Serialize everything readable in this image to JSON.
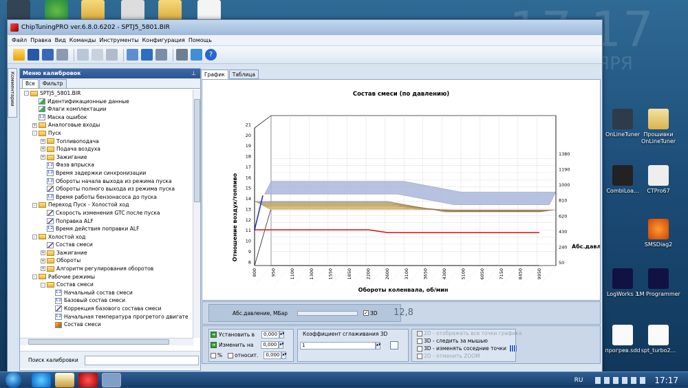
{
  "window": {
    "title": "ChipTuningPRO ver.6.8.0.6202 - SPTJ5_5801.BIR"
  },
  "menu": [
    "Файл",
    "Правка",
    "Вид",
    "Команды",
    "Инструменты",
    "Конфигурация",
    "Помощь"
  ],
  "sidetab_label": "Комментарии",
  "left_panel": {
    "title": "Меню калибровок",
    "pin": "⊥",
    "tabs": [
      "Все",
      "Фильтр"
    ],
    "search_label": "Поиск калибровки",
    "tree": [
      {
        "level": 0,
        "exp": "-",
        "icon": "folder",
        "label": "SPTJ5_5801.BIR"
      },
      {
        "level": 1,
        "exp": "",
        "icon": "leaf-g",
        "label": "Идентификационные данные"
      },
      {
        "level": 1,
        "exp": "",
        "icon": "leaf-g",
        "label": "Флаги комплектации"
      },
      {
        "level": 1,
        "exp": "",
        "icon": "leaf",
        "label": "Маска ошибок"
      },
      {
        "level": 1,
        "exp": "+",
        "icon": "folder",
        "label": "Аналоговые входы"
      },
      {
        "level": 1,
        "exp": "-",
        "icon": "folder",
        "label": "Пуск"
      },
      {
        "level": 2,
        "exp": "+",
        "icon": "folder",
        "label": "Топливоподача"
      },
      {
        "level": 2,
        "exp": "+",
        "icon": "folder",
        "label": "Подача воздуха"
      },
      {
        "level": 2,
        "exp": "+",
        "icon": "folder",
        "label": "Зажигание"
      },
      {
        "level": 2,
        "exp": "",
        "icon": "leaf",
        "label": "Фаза впрыска"
      },
      {
        "level": 2,
        "exp": "",
        "icon": "leaf",
        "label": "Время задержки синхронизации"
      },
      {
        "level": 2,
        "exp": "",
        "icon": "leaf",
        "label": "Обороты начала выхода из режима пуска"
      },
      {
        "level": 2,
        "exp": "",
        "icon": "leaf-m",
        "label": "Обороты полного выхода из режима пуска"
      },
      {
        "level": 2,
        "exp": "",
        "icon": "leaf",
        "label": "Время работы бензонасоса до пуска"
      },
      {
        "level": 1,
        "exp": "-",
        "icon": "folder",
        "label": "Переход Пуск - Холостой ход"
      },
      {
        "level": 2,
        "exp": "",
        "icon": "leaf-m",
        "label": "Скорость изменения GTC после пуска"
      },
      {
        "level": 2,
        "exp": "",
        "icon": "leaf-m",
        "label": "Поправка ALF"
      },
      {
        "level": 2,
        "exp": "",
        "icon": "leaf",
        "label": "Время действия поправки ALF"
      },
      {
        "level": 1,
        "exp": "-",
        "icon": "folder",
        "label": "Холостой ход"
      },
      {
        "level": 2,
        "exp": "",
        "icon": "leaf-m",
        "label": "Состав смеси"
      },
      {
        "level": 2,
        "exp": "+",
        "icon": "folder",
        "label": "Зажигание"
      },
      {
        "level": 2,
        "exp": "+",
        "icon": "folder",
        "label": "Обороты"
      },
      {
        "level": 2,
        "exp": "+",
        "icon": "folder",
        "label": "Алгоритм регулирования оборотов"
      },
      {
        "level": 1,
        "exp": "-",
        "icon": "folder",
        "label": "Рабочие режимы"
      },
      {
        "level": 2,
        "exp": "-",
        "icon": "folder",
        "label": "Состав смеси"
      },
      {
        "level": 3,
        "exp": "",
        "icon": "leaf",
        "label": "Начальный состав смеси"
      },
      {
        "level": 3,
        "exp": "",
        "icon": "leaf",
        "label": "Базовый состав смеси"
      },
      {
        "level": 3,
        "exp": "",
        "icon": "leaf-m",
        "label": "Коррекция базового состава смеси"
      },
      {
        "level": 3,
        "exp": "",
        "icon": "leaf",
        "label": "Начальная температура прогретого двигате"
      },
      {
        "level": 3,
        "exp": "",
        "icon": "leaf-c",
        "label": "Состав смеси"
      }
    ]
  },
  "right_tabs": [
    "График",
    "Таблица"
  ],
  "chart_data": {
    "type": "area",
    "title": "Состав смеси (по давлению)",
    "xlabel": "Обороты коленвала, об/мин",
    "ylabel": "Отношение воздух/топливо",
    "zlabel": "Абс.давлен",
    "x": [
      800,
      950,
      1100,
      1300,
      1550,
      1850,
      2200,
      2600,
      3100,
      3650,
      4300,
      5100,
      6050,
      7150,
      8450,
      9950
    ],
    "yticks": [
      8,
      9,
      10,
      11,
      12,
      13,
      14,
      15,
      16,
      17,
      18,
      19,
      20,
      21
    ],
    "ylim": [
      8,
      21
    ],
    "zticks": [
      50,
      240,
      430,
      620,
      810,
      1000,
      1190,
      1380
    ],
    "series": [
      {
        "values": [
          13,
          13,
          13,
          13,
          13,
          13,
          13,
          13,
          13,
          13,
          13,
          13,
          13,
          13,
          13,
          13
        ]
      },
      {
        "values": [
          17,
          17,
          17,
          17,
          17,
          17,
          17,
          17,
          16.5,
          16,
          15.5,
          15.5,
          15.5,
          15.5,
          15.5,
          15.5
        ]
      }
    ]
  },
  "control1": {
    "label": "Абс.давление, МБар",
    "cb3d": "3D",
    "value": "12,8"
  },
  "control2": {
    "set_label": "Установить в",
    "set_value": "0,000",
    "change_label": "Изменить на",
    "change_value": "0,000",
    "relative_label": "относит.",
    "relative_value": "0,000",
    "smooth_label": "Коэффициент сглаживания 3D",
    "smooth_value": "1",
    "opt1": "2D - отображать все точки графика",
    "opt2": "3D - следить за мышью",
    "opt3": "3D - изменять соседние точки",
    "opt4": "2D - отменить ZOOM"
  },
  "desktop": {
    "clock_big": "17:17",
    "clock_big2": "ЯРЯ",
    "icons": [
      "OnLineTuner",
      "Прошивки OnLineTuner",
      "CombiLoa...",
      "CTPro67",
      "SMSDiag2",
      "LogWorks 3",
      "LM Programmer",
      "прогрев.sdd",
      "spt_turbo2..."
    ]
  },
  "taskbar": {
    "lang": "RU",
    "time": "17:17"
  }
}
